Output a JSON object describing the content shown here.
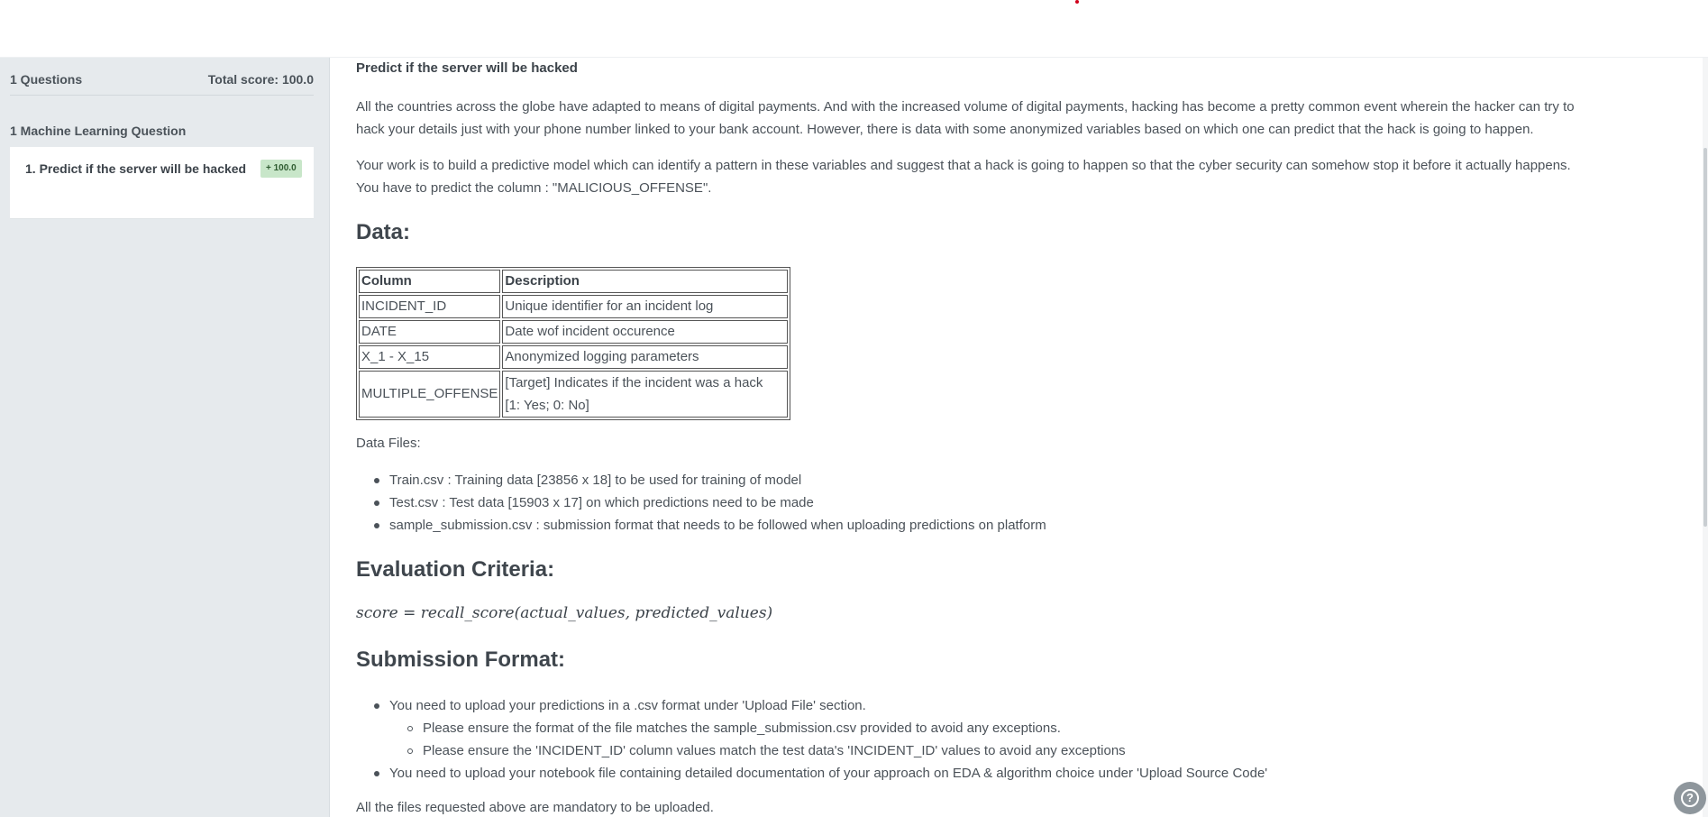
{
  "sidebar": {
    "questions_count": "1 Questions",
    "total_score": "Total score: 100.0",
    "section_title": "1 Machine Learning Question",
    "items": [
      {
        "label": "1. Predict if the server will be hacked",
        "badge": "+ 100.0"
      }
    ]
  },
  "main": {
    "title": "Predict if the server will be hacked",
    "paragraph1_line1": "All the countries across the globe have adapted to means of digital payments. And with the increased volume of digital payments, hacking has become a pretty common event wherein the hacker can try to",
    "paragraph1_line2": "hack your details just with your phone number linked to your bank account. However, there is data with some anonymized variables based on which one can predict that the hack is going to happen.",
    "paragraph2_line1": "Your work is to build a predictive model which can identify a pattern in these variables and suggest that a hack is going to happen so that the cyber security can somehow stop it before it actually happens.",
    "paragraph2_line2": "You have to predict the column : \"MALICIOUS_OFFENSE\".",
    "data_heading": "Data:",
    "table": {
      "headers": [
        "Column",
        "Description"
      ],
      "rows": [
        [
          "INCIDENT_ID",
          "Unique identifier for an incident log"
        ],
        [
          "DATE",
          "Date wof incident occurence"
        ],
        [
          "X_1 - X_15",
          "Anonymized logging parameters"
        ]
      ],
      "multi_row": {
        "col": "MULTIPLE_OFFENSE",
        "desc_line1": "[Target] Indicates if the incident was a hack",
        "desc_line2": "[1: Yes; 0: No]"
      }
    },
    "data_files_label": "Data Files:",
    "data_files": [
      "Train.csv : Training data [23856 x 18] to be used for training of model",
      "Test.csv : Test data [15903 x 17] on which predictions need to be made",
      "sample_submission.csv : submission format that needs to be followed when uploading predictions on platform"
    ],
    "eval_heading": "Evaluation Criteria:",
    "formula": "score = recall_score(actual_values, predicted_values)",
    "submission_heading": "Submission Format:",
    "submission_items": [
      "You need to upload your predictions in a .csv format under 'Upload File' section.",
      "You need to upload your notebook file containing detailed documentation of your approach on EDA & algorithm choice under 'Upload Source Code'"
    ],
    "submission_subitems": [
      "Please ensure the format of the file matches the sample_submission.csv provided to avoid any exceptions.",
      "Please ensure the 'INCIDENT_ID' column values match the test data's 'INCIDENT_ID' values to avoid any exceptions"
    ],
    "footnote": "All the files requested above are mandatory to be uploaded."
  },
  "help": {
    "icon": "help-icon",
    "glyph": "?"
  },
  "colors": {
    "badge_bg": "#c8e6c9",
    "sidebar_bg": "#e6eaed",
    "accent_dot": "#d0021b"
  }
}
